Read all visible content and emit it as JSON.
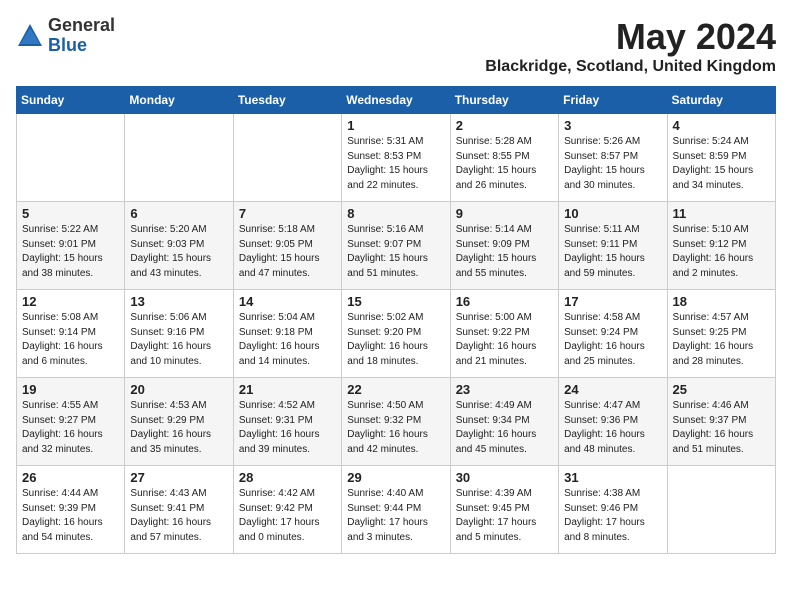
{
  "header": {
    "logo_general": "General",
    "logo_blue": "Blue",
    "title": "May 2024",
    "location": "Blackridge, Scotland, United Kingdom"
  },
  "days_of_week": [
    "Sunday",
    "Monday",
    "Tuesday",
    "Wednesday",
    "Thursday",
    "Friday",
    "Saturday"
  ],
  "weeks": [
    [
      {
        "day": "",
        "info": ""
      },
      {
        "day": "",
        "info": ""
      },
      {
        "day": "",
        "info": ""
      },
      {
        "day": "1",
        "info": "Sunrise: 5:31 AM\nSunset: 8:53 PM\nDaylight: 15 hours\nand 22 minutes."
      },
      {
        "day": "2",
        "info": "Sunrise: 5:28 AM\nSunset: 8:55 PM\nDaylight: 15 hours\nand 26 minutes."
      },
      {
        "day": "3",
        "info": "Sunrise: 5:26 AM\nSunset: 8:57 PM\nDaylight: 15 hours\nand 30 minutes."
      },
      {
        "day": "4",
        "info": "Sunrise: 5:24 AM\nSunset: 8:59 PM\nDaylight: 15 hours\nand 34 minutes."
      }
    ],
    [
      {
        "day": "5",
        "info": "Sunrise: 5:22 AM\nSunset: 9:01 PM\nDaylight: 15 hours\nand 38 minutes."
      },
      {
        "day": "6",
        "info": "Sunrise: 5:20 AM\nSunset: 9:03 PM\nDaylight: 15 hours\nand 43 minutes."
      },
      {
        "day": "7",
        "info": "Sunrise: 5:18 AM\nSunset: 9:05 PM\nDaylight: 15 hours\nand 47 minutes."
      },
      {
        "day": "8",
        "info": "Sunrise: 5:16 AM\nSunset: 9:07 PM\nDaylight: 15 hours\nand 51 minutes."
      },
      {
        "day": "9",
        "info": "Sunrise: 5:14 AM\nSunset: 9:09 PM\nDaylight: 15 hours\nand 55 minutes."
      },
      {
        "day": "10",
        "info": "Sunrise: 5:11 AM\nSunset: 9:11 PM\nDaylight: 15 hours\nand 59 minutes."
      },
      {
        "day": "11",
        "info": "Sunrise: 5:10 AM\nSunset: 9:12 PM\nDaylight: 16 hours\nand 2 minutes."
      }
    ],
    [
      {
        "day": "12",
        "info": "Sunrise: 5:08 AM\nSunset: 9:14 PM\nDaylight: 16 hours\nand 6 minutes."
      },
      {
        "day": "13",
        "info": "Sunrise: 5:06 AM\nSunset: 9:16 PM\nDaylight: 16 hours\nand 10 minutes."
      },
      {
        "day": "14",
        "info": "Sunrise: 5:04 AM\nSunset: 9:18 PM\nDaylight: 16 hours\nand 14 minutes."
      },
      {
        "day": "15",
        "info": "Sunrise: 5:02 AM\nSunset: 9:20 PM\nDaylight: 16 hours\nand 18 minutes."
      },
      {
        "day": "16",
        "info": "Sunrise: 5:00 AM\nSunset: 9:22 PM\nDaylight: 16 hours\nand 21 minutes."
      },
      {
        "day": "17",
        "info": "Sunrise: 4:58 AM\nSunset: 9:24 PM\nDaylight: 16 hours\nand 25 minutes."
      },
      {
        "day": "18",
        "info": "Sunrise: 4:57 AM\nSunset: 9:25 PM\nDaylight: 16 hours\nand 28 minutes."
      }
    ],
    [
      {
        "day": "19",
        "info": "Sunrise: 4:55 AM\nSunset: 9:27 PM\nDaylight: 16 hours\nand 32 minutes."
      },
      {
        "day": "20",
        "info": "Sunrise: 4:53 AM\nSunset: 9:29 PM\nDaylight: 16 hours\nand 35 minutes."
      },
      {
        "day": "21",
        "info": "Sunrise: 4:52 AM\nSunset: 9:31 PM\nDaylight: 16 hours\nand 39 minutes."
      },
      {
        "day": "22",
        "info": "Sunrise: 4:50 AM\nSunset: 9:32 PM\nDaylight: 16 hours\nand 42 minutes."
      },
      {
        "day": "23",
        "info": "Sunrise: 4:49 AM\nSunset: 9:34 PM\nDaylight: 16 hours\nand 45 minutes."
      },
      {
        "day": "24",
        "info": "Sunrise: 4:47 AM\nSunset: 9:36 PM\nDaylight: 16 hours\nand 48 minutes."
      },
      {
        "day": "25",
        "info": "Sunrise: 4:46 AM\nSunset: 9:37 PM\nDaylight: 16 hours\nand 51 minutes."
      }
    ],
    [
      {
        "day": "26",
        "info": "Sunrise: 4:44 AM\nSunset: 9:39 PM\nDaylight: 16 hours\nand 54 minutes."
      },
      {
        "day": "27",
        "info": "Sunrise: 4:43 AM\nSunset: 9:41 PM\nDaylight: 16 hours\nand 57 minutes."
      },
      {
        "day": "28",
        "info": "Sunrise: 4:42 AM\nSunset: 9:42 PM\nDaylight: 17 hours\nand 0 minutes."
      },
      {
        "day": "29",
        "info": "Sunrise: 4:40 AM\nSunset: 9:44 PM\nDaylight: 17 hours\nand 3 minutes."
      },
      {
        "day": "30",
        "info": "Sunrise: 4:39 AM\nSunset: 9:45 PM\nDaylight: 17 hours\nand 5 minutes."
      },
      {
        "day": "31",
        "info": "Sunrise: 4:38 AM\nSunset: 9:46 PM\nDaylight: 17 hours\nand 8 minutes."
      },
      {
        "day": "",
        "info": ""
      }
    ]
  ]
}
